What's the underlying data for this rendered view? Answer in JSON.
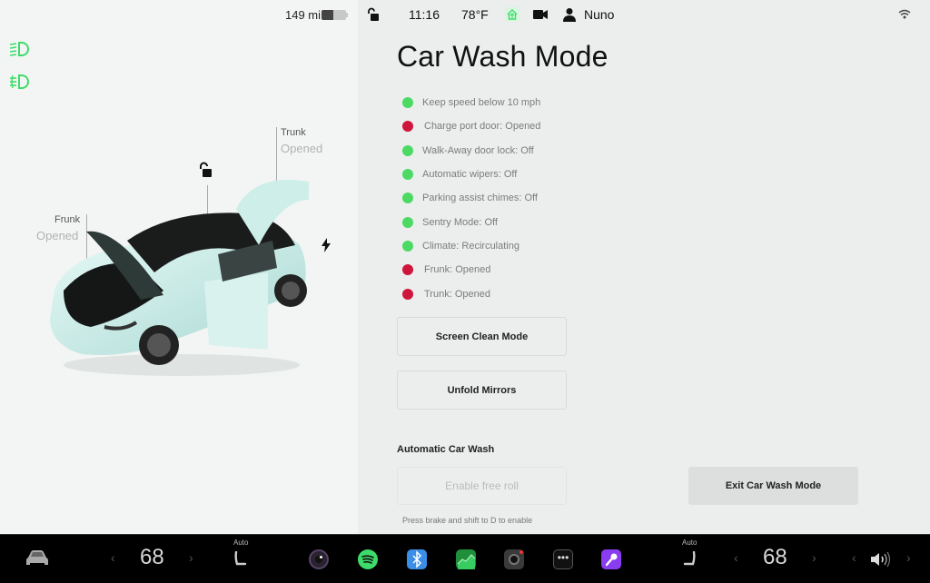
{
  "status_bar": {
    "range": "149 mi",
    "battery_level_percent": 50,
    "time": "11:16",
    "temperature": "78°F",
    "user_name": "Nuno"
  },
  "car_view": {
    "trunk_label": "Trunk",
    "trunk_state": "Opened",
    "frunk_label": "Frunk",
    "frunk_state": "Opened"
  },
  "main": {
    "title": "Car Wash Mode",
    "checklist": [
      {
        "text": "Keep speed below 10 mph",
        "status": "ok"
      },
      {
        "text": "Charge port door: Opened",
        "status": "bad"
      },
      {
        "text": "Walk-Away door lock: Off",
        "status": "ok"
      },
      {
        "text": "Automatic wipers: Off",
        "status": "ok"
      },
      {
        "text": "Parking assist chimes: Off",
        "status": "ok"
      },
      {
        "text": "Sentry Mode: Off",
        "status": "ok"
      },
      {
        "text": "Climate:  Recirculating",
        "status": "ok"
      },
      {
        "text": "Frunk: Opened",
        "status": "bad"
      },
      {
        "text": "Trunk: Opened",
        "status": "bad"
      }
    ],
    "screen_clean_label": "Screen Clean Mode",
    "unfold_mirrors_label": "Unfold Mirrors",
    "auto_wash_title": "Automatic Car Wash",
    "free_roll_label": "Enable free roll",
    "free_roll_hint": "Press brake and shift to D to enable",
    "exit_label": "Exit Car Wash Mode"
  },
  "bottom_bar": {
    "driver_temp": "68",
    "passenger_temp": "68",
    "driver_seat_mode": "Auto",
    "passenger_seat_mode": "Auto",
    "apps": [
      "camera",
      "spotify",
      "bluetooth",
      "stocks",
      "dashcam",
      "more",
      "karaoke"
    ]
  },
  "colors": {
    "ok": "#4cd964",
    "bad": "#d0153c",
    "accent_green": "#3ddc6a"
  }
}
